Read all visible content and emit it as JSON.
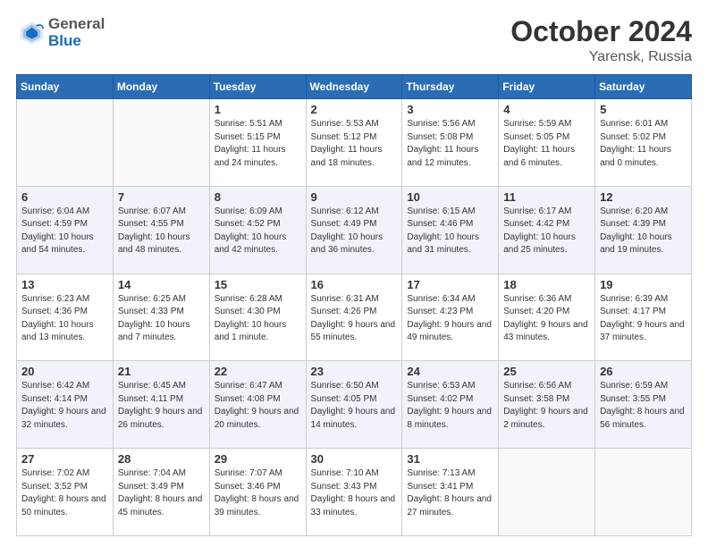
{
  "header": {
    "logo_line1": "General",
    "logo_line2": "Blue",
    "month_title": "October 2024",
    "location": "Yarensk, Russia"
  },
  "weekdays": [
    "Sunday",
    "Monday",
    "Tuesday",
    "Wednesday",
    "Thursday",
    "Friday",
    "Saturday"
  ],
  "weeks": [
    [
      {
        "day": "",
        "sunrise": "",
        "sunset": "",
        "daylight": ""
      },
      {
        "day": "",
        "sunrise": "",
        "sunset": "",
        "daylight": ""
      },
      {
        "day": "1",
        "sunrise": "Sunrise: 5:51 AM",
        "sunset": "Sunset: 5:15 PM",
        "daylight": "Daylight: 11 hours and 24 minutes."
      },
      {
        "day": "2",
        "sunrise": "Sunrise: 5:53 AM",
        "sunset": "Sunset: 5:12 PM",
        "daylight": "Daylight: 11 hours and 18 minutes."
      },
      {
        "day": "3",
        "sunrise": "Sunrise: 5:56 AM",
        "sunset": "Sunset: 5:08 PM",
        "daylight": "Daylight: 11 hours and 12 minutes."
      },
      {
        "day": "4",
        "sunrise": "Sunrise: 5:59 AM",
        "sunset": "Sunset: 5:05 PM",
        "daylight": "Daylight: 11 hours and 6 minutes."
      },
      {
        "day": "5",
        "sunrise": "Sunrise: 6:01 AM",
        "sunset": "Sunset: 5:02 PM",
        "daylight": "Daylight: 11 hours and 0 minutes."
      }
    ],
    [
      {
        "day": "6",
        "sunrise": "Sunrise: 6:04 AM",
        "sunset": "Sunset: 4:59 PM",
        "daylight": "Daylight: 10 hours and 54 minutes."
      },
      {
        "day": "7",
        "sunrise": "Sunrise: 6:07 AM",
        "sunset": "Sunset: 4:55 PM",
        "daylight": "Daylight: 10 hours and 48 minutes."
      },
      {
        "day": "8",
        "sunrise": "Sunrise: 6:09 AM",
        "sunset": "Sunset: 4:52 PM",
        "daylight": "Daylight: 10 hours and 42 minutes."
      },
      {
        "day": "9",
        "sunrise": "Sunrise: 6:12 AM",
        "sunset": "Sunset: 4:49 PM",
        "daylight": "Daylight: 10 hours and 36 minutes."
      },
      {
        "day": "10",
        "sunrise": "Sunrise: 6:15 AM",
        "sunset": "Sunset: 4:46 PM",
        "daylight": "Daylight: 10 hours and 31 minutes."
      },
      {
        "day": "11",
        "sunrise": "Sunrise: 6:17 AM",
        "sunset": "Sunset: 4:42 PM",
        "daylight": "Daylight: 10 hours and 25 minutes."
      },
      {
        "day": "12",
        "sunrise": "Sunrise: 6:20 AM",
        "sunset": "Sunset: 4:39 PM",
        "daylight": "Daylight: 10 hours and 19 minutes."
      }
    ],
    [
      {
        "day": "13",
        "sunrise": "Sunrise: 6:23 AM",
        "sunset": "Sunset: 4:36 PM",
        "daylight": "Daylight: 10 hours and 13 minutes."
      },
      {
        "day": "14",
        "sunrise": "Sunrise: 6:25 AM",
        "sunset": "Sunset: 4:33 PM",
        "daylight": "Daylight: 10 hours and 7 minutes."
      },
      {
        "day": "15",
        "sunrise": "Sunrise: 6:28 AM",
        "sunset": "Sunset: 4:30 PM",
        "daylight": "Daylight: 10 hours and 1 minute."
      },
      {
        "day": "16",
        "sunrise": "Sunrise: 6:31 AM",
        "sunset": "Sunset: 4:26 PM",
        "daylight": "Daylight: 9 hours and 55 minutes."
      },
      {
        "day": "17",
        "sunrise": "Sunrise: 6:34 AM",
        "sunset": "Sunset: 4:23 PM",
        "daylight": "Daylight: 9 hours and 49 minutes."
      },
      {
        "day": "18",
        "sunrise": "Sunrise: 6:36 AM",
        "sunset": "Sunset: 4:20 PM",
        "daylight": "Daylight: 9 hours and 43 minutes."
      },
      {
        "day": "19",
        "sunrise": "Sunrise: 6:39 AM",
        "sunset": "Sunset: 4:17 PM",
        "daylight": "Daylight: 9 hours and 37 minutes."
      }
    ],
    [
      {
        "day": "20",
        "sunrise": "Sunrise: 6:42 AM",
        "sunset": "Sunset: 4:14 PM",
        "daylight": "Daylight: 9 hours and 32 minutes."
      },
      {
        "day": "21",
        "sunrise": "Sunrise: 6:45 AM",
        "sunset": "Sunset: 4:11 PM",
        "daylight": "Daylight: 9 hours and 26 minutes."
      },
      {
        "day": "22",
        "sunrise": "Sunrise: 6:47 AM",
        "sunset": "Sunset: 4:08 PM",
        "daylight": "Daylight: 9 hours and 20 minutes."
      },
      {
        "day": "23",
        "sunrise": "Sunrise: 6:50 AM",
        "sunset": "Sunset: 4:05 PM",
        "daylight": "Daylight: 9 hours and 14 minutes."
      },
      {
        "day": "24",
        "sunrise": "Sunrise: 6:53 AM",
        "sunset": "Sunset: 4:02 PM",
        "daylight": "Daylight: 9 hours and 8 minutes."
      },
      {
        "day": "25",
        "sunrise": "Sunrise: 6:56 AM",
        "sunset": "Sunset: 3:58 PM",
        "daylight": "Daylight: 9 hours and 2 minutes."
      },
      {
        "day": "26",
        "sunrise": "Sunrise: 6:59 AM",
        "sunset": "Sunset: 3:55 PM",
        "daylight": "Daylight: 8 hours and 56 minutes."
      }
    ],
    [
      {
        "day": "27",
        "sunrise": "Sunrise: 7:02 AM",
        "sunset": "Sunset: 3:52 PM",
        "daylight": "Daylight: 8 hours and 50 minutes."
      },
      {
        "day": "28",
        "sunrise": "Sunrise: 7:04 AM",
        "sunset": "Sunset: 3:49 PM",
        "daylight": "Daylight: 8 hours and 45 minutes."
      },
      {
        "day": "29",
        "sunrise": "Sunrise: 7:07 AM",
        "sunset": "Sunset: 3:46 PM",
        "daylight": "Daylight: 8 hours and 39 minutes."
      },
      {
        "day": "30",
        "sunrise": "Sunrise: 7:10 AM",
        "sunset": "Sunset: 3:43 PM",
        "daylight": "Daylight: 8 hours and 33 minutes."
      },
      {
        "day": "31",
        "sunrise": "Sunrise: 7:13 AM",
        "sunset": "Sunset: 3:41 PM",
        "daylight": "Daylight: 8 hours and 27 minutes."
      },
      {
        "day": "",
        "sunrise": "",
        "sunset": "",
        "daylight": ""
      },
      {
        "day": "",
        "sunrise": "",
        "sunset": "",
        "daylight": ""
      }
    ]
  ]
}
